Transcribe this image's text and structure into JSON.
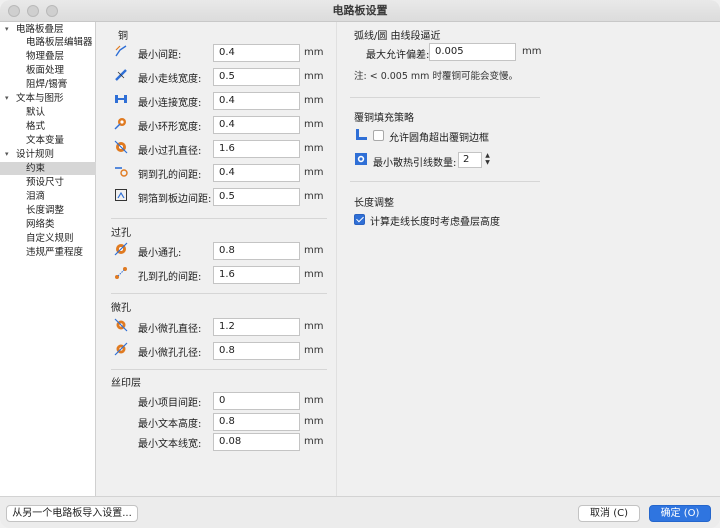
{
  "window": {
    "title": "电路板设置"
  },
  "sidebar": {
    "items": [
      {
        "label": "电路板叠层",
        "indent": 0,
        "chevron": "▾"
      },
      {
        "label": "电路板层编辑器",
        "indent": 1
      },
      {
        "label": "物理叠层",
        "indent": 1
      },
      {
        "label": "板面处理",
        "indent": 1
      },
      {
        "label": "阻焊/锡膏",
        "indent": 1
      },
      {
        "label": "文本与图形",
        "indent": 0,
        "chevron": "▾"
      },
      {
        "label": "默认",
        "indent": 1
      },
      {
        "label": "格式",
        "indent": 1
      },
      {
        "label": "文本变量",
        "indent": 1
      },
      {
        "label": "设计规则",
        "indent": 0,
        "chevron": "▾"
      },
      {
        "label": "约束",
        "indent": 1,
        "selected": true
      },
      {
        "label": "预设尺寸",
        "indent": 1
      },
      {
        "label": "泪滴",
        "indent": 1
      },
      {
        "label": "长度调整",
        "indent": 1
      },
      {
        "label": "网络类",
        "indent": 1
      },
      {
        "label": "自定义规则",
        "indent": 1
      },
      {
        "label": "违规严重程度",
        "indent": 1
      }
    ]
  },
  "copper": {
    "title": "铜",
    "rows": [
      {
        "label": "最小间距:",
        "value": "0.4",
        "unit": "mm",
        "icon": "clearance-icon"
      },
      {
        "label": "最小走线宽度:",
        "value": "0.5",
        "unit": "mm",
        "icon": "track-width-icon"
      },
      {
        "label": "最小连接宽度:",
        "value": "0.4",
        "unit": "mm",
        "icon": "connection-width-icon"
      },
      {
        "label": "最小环形宽度:",
        "value": "0.4",
        "unit": "mm",
        "icon": "annular-ring-icon"
      },
      {
        "label": "最小过孔直径:",
        "value": "1.6",
        "unit": "mm",
        "icon": "via-diameter-icon"
      },
      {
        "label": "铜到孔的间距:",
        "value": "0.4",
        "unit": "mm",
        "icon": "copper-hole-icon"
      },
      {
        "label": "铜箔到板边间距:",
        "value": "0.5",
        "unit": "mm",
        "icon": "copper-edge-icon"
      }
    ]
  },
  "vias": {
    "title": "过孔",
    "rows": [
      {
        "label": "最小通孔:",
        "value": "0.8",
        "unit": "mm",
        "icon": "through-hole-icon"
      },
      {
        "label": "孔到孔的间距:",
        "value": "1.6",
        "unit": "mm",
        "icon": "hole-to-hole-icon"
      }
    ]
  },
  "microvias": {
    "title": "微孔",
    "rows": [
      {
        "label": "最小微孔直径:",
        "value": "1.2",
        "unit": "mm",
        "icon": "microvia-diameter-icon"
      },
      {
        "label": "最小微孔孔径:",
        "value": "0.8",
        "unit": "mm",
        "icon": "microvia-drill-icon"
      }
    ]
  },
  "silkscreen": {
    "title": "丝印层",
    "rows": [
      {
        "label": "最小项目间距:",
        "value": "0",
        "unit": "mm"
      },
      {
        "label": "最小文本高度:",
        "value": "0.8",
        "unit": "mm"
      },
      {
        "label": "最小文本线宽:",
        "value": "0.08",
        "unit": "mm"
      }
    ]
  },
  "arcs": {
    "title": "弧线/圆 由线段逼近",
    "label": "最大允许偏差:",
    "value": "0.005",
    "unit": "mm",
    "note": "注: < 0.005 mm 时覆铜可能会变慢。"
  },
  "zone_fill": {
    "title": "覆铜填充策略",
    "allow_fillet": {
      "label": "允许圆角超出覆铜边框",
      "checked": false
    },
    "thermal_spokes": {
      "label": "最小散热引线数量:",
      "value": "2"
    }
  },
  "length_tuning": {
    "title": "长度调整",
    "stackup_height": {
      "label": "计算走线长度时考虑叠层高度",
      "checked": true
    }
  },
  "footer": {
    "import_label": "从另一个电路板导入设置...",
    "cancel_label": "取消 (C)",
    "ok_label": "确定 (O)"
  },
  "colors": {
    "accent": "#2f75e0",
    "icon_orange": "#e07a20",
    "icon_blue": "#2f6fd6"
  }
}
